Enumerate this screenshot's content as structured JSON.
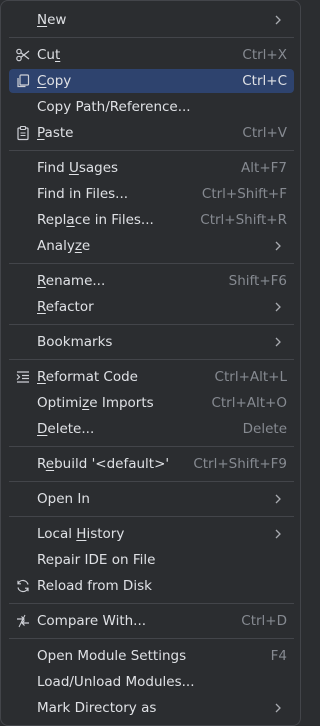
{
  "menu": {
    "new": {
      "label_before": "",
      "mnemonic": "N",
      "label_after": "ew"
    },
    "cut": {
      "label_before": "Cu",
      "mnemonic": "t",
      "label_after": "",
      "shortcut": "Ctrl+X",
      "icon": "scissors-icon"
    },
    "copy": {
      "label_before": "",
      "mnemonic": "C",
      "label_after": "opy",
      "shortcut": "Ctrl+C",
      "icon": "copy-icon"
    },
    "copy_path": {
      "label": "Copy Path/Reference..."
    },
    "paste": {
      "label_before": "",
      "mnemonic": "P",
      "label_after": "aste",
      "shortcut": "Ctrl+V",
      "icon": "paste-icon"
    },
    "find_usages": {
      "label_before": "Find ",
      "mnemonic": "U",
      "label_after": "sages",
      "shortcut": "Alt+F7"
    },
    "find_in_files": {
      "label": "Find in Files...",
      "shortcut": "Ctrl+Shift+F"
    },
    "replace_in_files": {
      "label_before": "Repl",
      "mnemonic": "a",
      "label_after": "ce in Files...",
      "shortcut": "Ctrl+Shift+R"
    },
    "analyze": {
      "label_before": "Analy",
      "mnemonic": "z",
      "label_after": "e"
    },
    "rename": {
      "label_before": "",
      "mnemonic": "R",
      "label_after": "ename...",
      "shortcut": "Shift+F6"
    },
    "refactor": {
      "label_before": "",
      "mnemonic": "R",
      "label_after": "efactor"
    },
    "bookmarks": {
      "label": "Bookmarks"
    },
    "reformat_code": {
      "label_before": "",
      "mnemonic": "R",
      "label_after": "eformat Code",
      "shortcut": "Ctrl+Alt+L",
      "icon": "reformat-icon"
    },
    "optimize_imports": {
      "label_before": "Optimi",
      "mnemonic": "z",
      "label_after": "e Imports",
      "shortcut": "Ctrl+Alt+O"
    },
    "delete": {
      "label_before": "",
      "mnemonic": "D",
      "label_after": "elete...",
      "shortcut": "Delete"
    },
    "rebuild": {
      "label_before": "R",
      "mnemonic": "e",
      "label_after": "build '<default>'",
      "shortcut": "Ctrl+Shift+F9"
    },
    "open_in": {
      "label": "Open In"
    },
    "local_history": {
      "label_before": "Local ",
      "mnemonic": "H",
      "label_after": "istory"
    },
    "repair_ide": {
      "label": "Repair IDE on File"
    },
    "reload_from_disk": {
      "label": "Reload from Disk",
      "icon": "reload-icon"
    },
    "compare_with": {
      "label": "Compare With...",
      "shortcut": "Ctrl+D",
      "icon": "compare-icon"
    },
    "open_module_settings": {
      "label": "Open Module Settings",
      "shortcut": "F4"
    },
    "load_unload_modules": {
      "label": "Load/Unload Modules..."
    },
    "mark_directory_as": {
      "label": "Mark Directory as"
    }
  },
  "colors": {
    "background": "#2b2d30",
    "selection": "#2e436e",
    "text": "#dfe1e5",
    "shortcut": "#868a91",
    "separator": "#43454a"
  }
}
